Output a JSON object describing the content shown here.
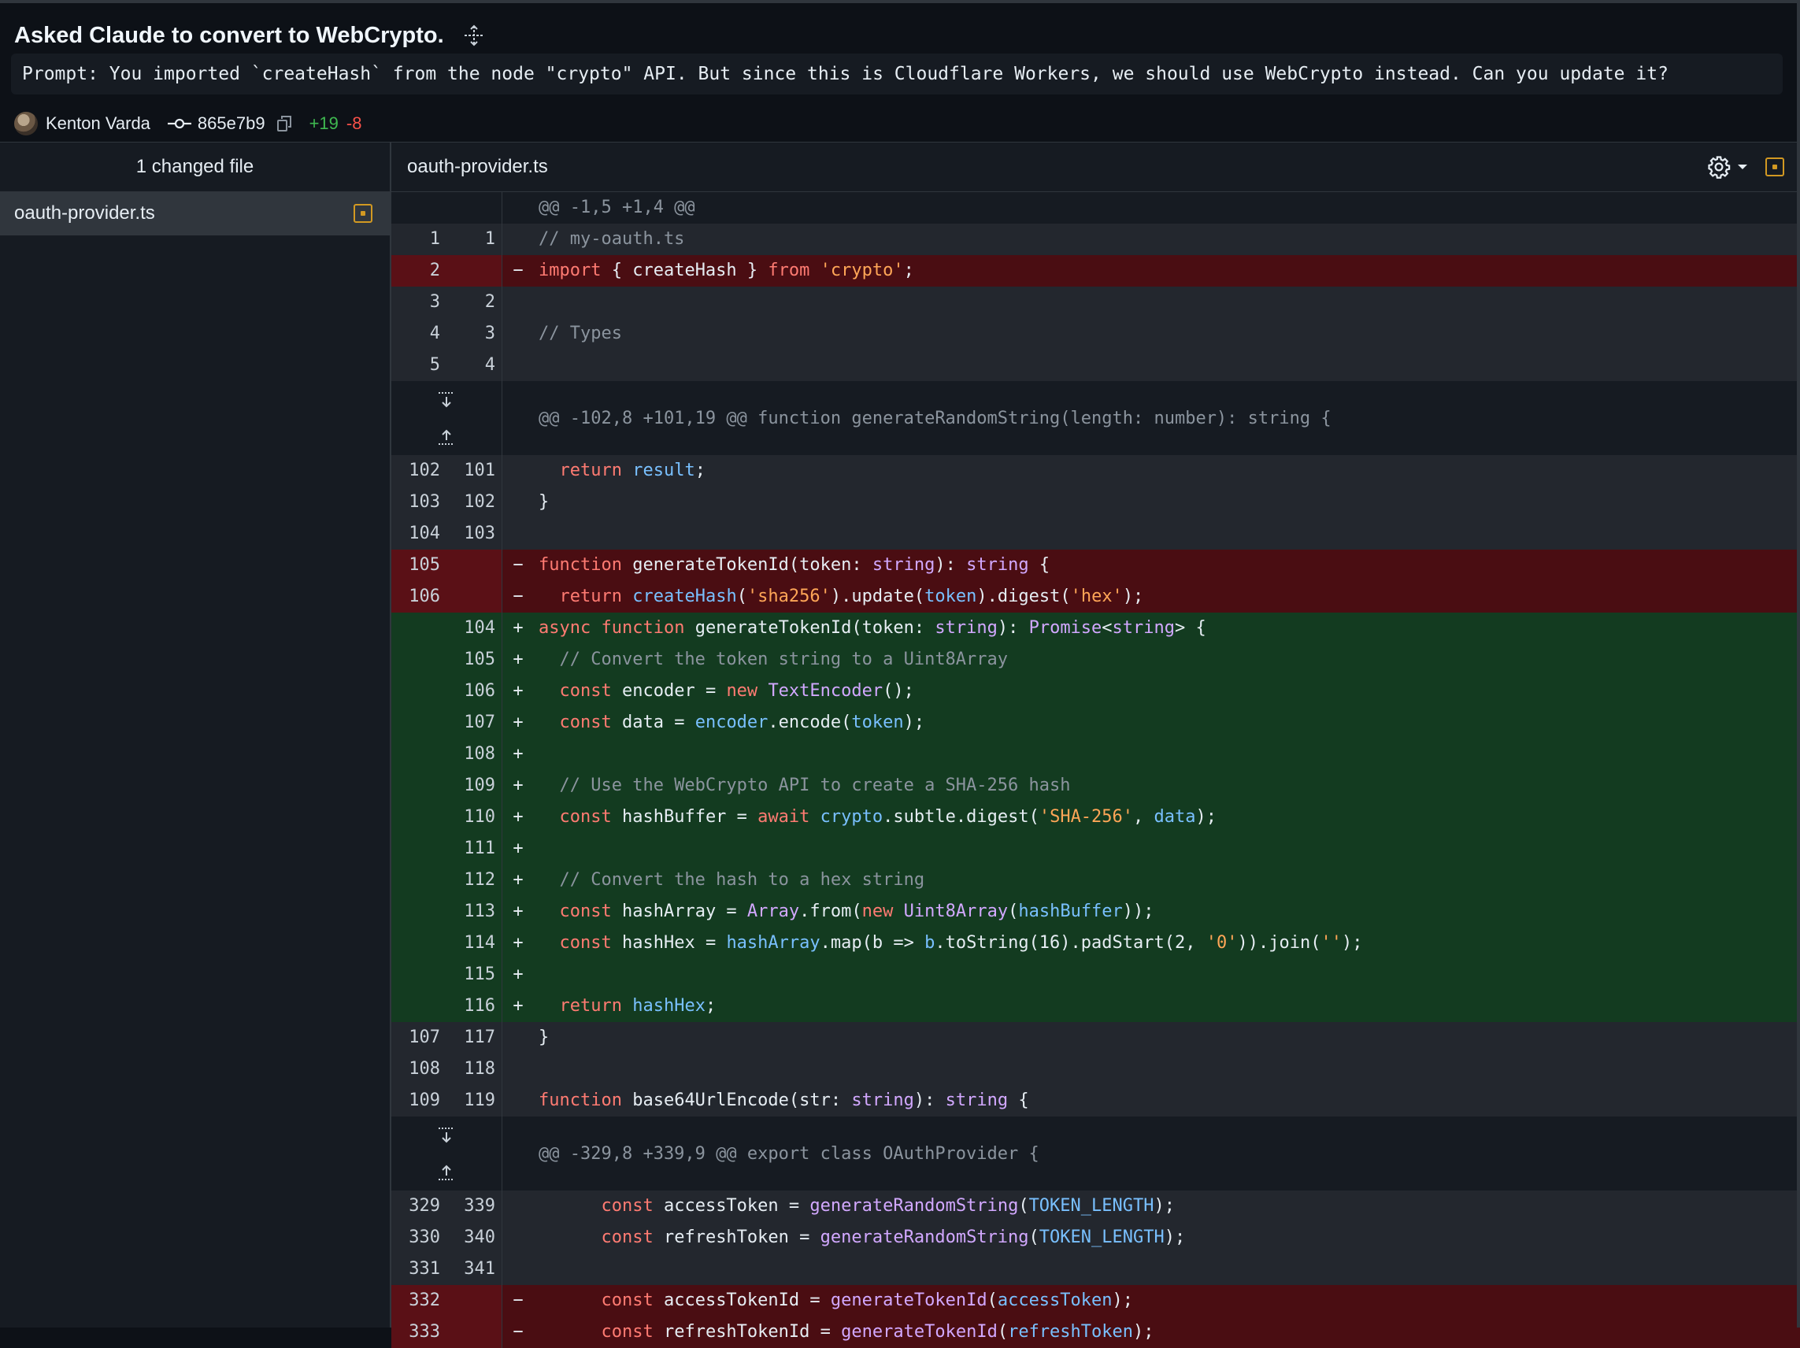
{
  "header": {
    "title": "Asked Claude to convert to WebCrypto.",
    "prompt": "Prompt: You imported `createHash` from the node \"crypto\" API. But since this is Cloudflare Workers, we should use WebCrypto instead. Can you update it?",
    "author": "Kenton Varda",
    "commit_sha": "865e7b9",
    "additions": "+19",
    "deletions": "-8"
  },
  "sidebar": {
    "heading": "1 changed file",
    "files": [
      {
        "name": "oauth-provider.ts"
      }
    ]
  },
  "file": {
    "name": "oauth-provider.ts"
  },
  "colors": {
    "added": "#3fb950",
    "deleted": "#f85149",
    "modified_icon": "#d29922"
  },
  "icons": [
    "move-icon",
    "commit-icon",
    "copy-icon",
    "gear-icon",
    "chevron-down-icon",
    "file-modified-icon",
    "expand-down-icon",
    "expand-up-icon"
  ],
  "diff": {
    "hunk1": "@@ -1,5 +1,4 @@",
    "hunk2": "@@ -102,8 +101,19 @@ function generateRandomString(length: number): string {",
    "hunk3": "@@ -329,8 +339,9 @@ export class OAuthProvider {",
    "lines": [
      {
        "old": "1",
        "new": "1",
        "mark": "",
        "type": "ctx"
      },
      {
        "old": "2",
        "new": "",
        "mark": "−",
        "type": "del"
      },
      {
        "old": "3",
        "new": "2",
        "mark": "",
        "type": "ctx"
      },
      {
        "old": "4",
        "new": "3",
        "mark": "",
        "type": "ctx"
      },
      {
        "old": "5",
        "new": "4",
        "mark": "",
        "type": "ctx"
      },
      {
        "old": "102",
        "new": "101",
        "mark": "",
        "type": "ctx"
      },
      {
        "old": "103",
        "new": "102",
        "mark": "",
        "type": "ctx"
      },
      {
        "old": "104",
        "new": "103",
        "mark": "",
        "type": "ctx"
      },
      {
        "old": "105",
        "new": "",
        "mark": "−",
        "type": "del"
      },
      {
        "old": "106",
        "new": "",
        "mark": "−",
        "type": "del"
      },
      {
        "old": "",
        "new": "104",
        "mark": "+",
        "type": "add"
      },
      {
        "old": "",
        "new": "105",
        "mark": "+",
        "type": "add"
      },
      {
        "old": "",
        "new": "106",
        "mark": "+",
        "type": "add"
      },
      {
        "old": "",
        "new": "107",
        "mark": "+",
        "type": "add"
      },
      {
        "old": "",
        "new": "108",
        "mark": "+",
        "type": "add"
      },
      {
        "old": "",
        "new": "109",
        "mark": "+",
        "type": "add"
      },
      {
        "old": "",
        "new": "110",
        "mark": "+",
        "type": "add"
      },
      {
        "old": "",
        "new": "111",
        "mark": "+",
        "type": "add"
      },
      {
        "old": "",
        "new": "112",
        "mark": "+",
        "type": "add"
      },
      {
        "old": "",
        "new": "113",
        "mark": "+",
        "type": "add"
      },
      {
        "old": "",
        "new": "114",
        "mark": "+",
        "type": "add"
      },
      {
        "old": "",
        "new": "115",
        "mark": "+",
        "type": "add"
      },
      {
        "old": "",
        "new": "116",
        "mark": "+",
        "type": "add"
      },
      {
        "old": "107",
        "new": "117",
        "mark": "",
        "type": "ctx"
      },
      {
        "old": "108",
        "new": "118",
        "mark": "",
        "type": "ctx"
      },
      {
        "old": "109",
        "new": "119",
        "mark": "",
        "type": "ctx"
      },
      {
        "old": "329",
        "new": "339",
        "mark": "",
        "type": "ctx"
      },
      {
        "old": "330",
        "new": "340",
        "mark": "",
        "type": "ctx"
      },
      {
        "old": "331",
        "new": "341",
        "mark": "",
        "type": "ctx"
      },
      {
        "old": "332",
        "new": "",
        "mark": "−",
        "type": "del"
      },
      {
        "old": "333",
        "new": "",
        "mark": "−",
        "type": "del"
      }
    ],
    "code": {
      "l0": [
        "// my-oauth.ts"
      ],
      "l1": [
        "import",
        " { createHash } ",
        "from",
        " ",
        "'crypto'",
        ";"
      ],
      "l2": [
        ""
      ],
      "l3": [
        "// Types"
      ],
      "l4": [
        ""
      ],
      "l5": [
        "  ",
        "return",
        " ",
        "result",
        ";"
      ],
      "l6": [
        "}"
      ],
      "l7": [
        ""
      ],
      "l8": [
        "function",
        " generateTokenId(token: ",
        "string",
        "): ",
        "string",
        " {"
      ],
      "l9": [
        "  ",
        "return",
        " ",
        "createHash",
        "(",
        "'sha256'",
        ").update(",
        "token",
        ").digest(",
        "'hex'",
        ");"
      ],
      "l10": [
        "async",
        " ",
        "function",
        " generateTokenId(token: ",
        "string",
        "): ",
        "Promise",
        "<",
        "string",
        "> {"
      ],
      "l11": [
        "  // Convert the token string to a Uint8Array"
      ],
      "l12": [
        "  ",
        "const",
        " encoder = ",
        "new",
        " ",
        "TextEncoder",
        "();"
      ],
      "l13": [
        "  ",
        "const",
        " data = ",
        "encoder",
        ".encode(",
        "token",
        ");"
      ],
      "l14": [
        ""
      ],
      "l15": [
        "  // Use the WebCrypto API to create a SHA-256 hash"
      ],
      "l16": [
        "  ",
        "const",
        " hashBuffer = ",
        "await",
        " ",
        "crypto",
        ".subtle.digest(",
        "'SHA-256'",
        ", ",
        "data",
        ");"
      ],
      "l17": [
        ""
      ],
      "l18": [
        "  // Convert the hash to a hex string"
      ],
      "l19": [
        "  ",
        "const",
        " hashArray = ",
        "Array",
        ".from(",
        "new",
        " ",
        "Uint8Array",
        "(",
        "hashBuffer",
        "));"
      ],
      "l20": [
        "  ",
        "const",
        " hashHex = ",
        "hashArray",
        ".map(b => ",
        "b",
        ".toString(16).padStart(2, ",
        "'0'",
        ")).join(",
        "''",
        ");"
      ],
      "l21": [
        ""
      ],
      "l22": [
        "  ",
        "return",
        " ",
        "hashHex",
        ";"
      ],
      "l23": [
        "}"
      ],
      "l24": [
        ""
      ],
      "l25": [
        "function",
        " base64UrlEncode(str: ",
        "string",
        "): ",
        "string",
        " {"
      ],
      "l26": [
        "      ",
        "const",
        " accessToken = ",
        "generateRandomString",
        "(",
        "TOKEN_LENGTH",
        ");"
      ],
      "l27": [
        "      ",
        "const",
        " refreshToken = ",
        "generateRandomString",
        "(",
        "TOKEN_LENGTH",
        ");"
      ],
      "l28": [
        ""
      ],
      "l29": [
        "      ",
        "const",
        " accessTokenId = ",
        "generateTokenId",
        "(",
        "accessToken",
        ");"
      ],
      "l30": [
        "      ",
        "const",
        " refreshTokenId = ",
        "generateTokenId",
        "(",
        "refreshToken",
        ");"
      ]
    }
  }
}
